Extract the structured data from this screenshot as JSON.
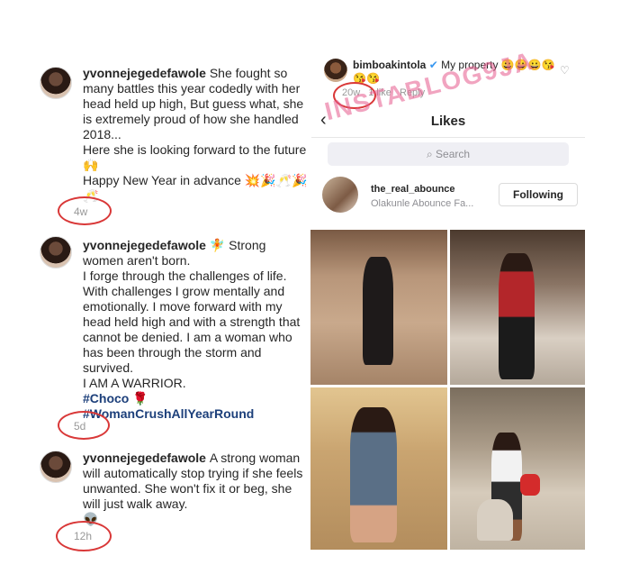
{
  "comments": [
    {
      "username": "yvonnejegedefawole",
      "lines": [
        "She fought so many battles this year codedly with her head held up high, But guess what, she is extremely proud of how she handled 2018...",
        "Here she is looking forward to the future 🙌",
        "Happy New Year in advance 💥🎉🥂🎉🥂"
      ],
      "time": "4w"
    },
    {
      "username": "yvonnejegedefawole",
      "lines": [
        "🧚 Strong women aren't born.",
        "I forge through the challenges of life. With challenges I grow mentally and emotionally. I move forward with my head held high and with a strength that cannot be denied. I am a woman who has been through the storm and survived.",
        "I AM A WARRIOR."
      ],
      "hashtags": [
        "#Choco 🌹",
        "#WomanCrushAllYearRound"
      ],
      "time": "5d"
    },
    {
      "username": "yvonnejegedefawole",
      "lines": [
        "A strong woman will automatically stop trying if she feels unwanted. She won't fix it or beg, she will just walk away.",
        "👽"
      ],
      "time": "12h"
    }
  ],
  "right_panel": {
    "top_comment": {
      "username": "bimboakintola",
      "text": "My property 😀😀😀😘😘😘",
      "time": "20w",
      "likes": "1 like",
      "reply": "Reply"
    },
    "watermark": "INSTABLOG9JA",
    "header_title": "Likes",
    "back_icon": "‹",
    "search_placeholder": "Search",
    "liker": {
      "username": "the_real_abounce",
      "full_name": "Olakunle Abounce Fa...",
      "button": "Following"
    }
  },
  "colors": {
    "annotation_circle": "#d93838",
    "hashtag": "#1c3f7a",
    "watermark": "#e65a8c"
  }
}
